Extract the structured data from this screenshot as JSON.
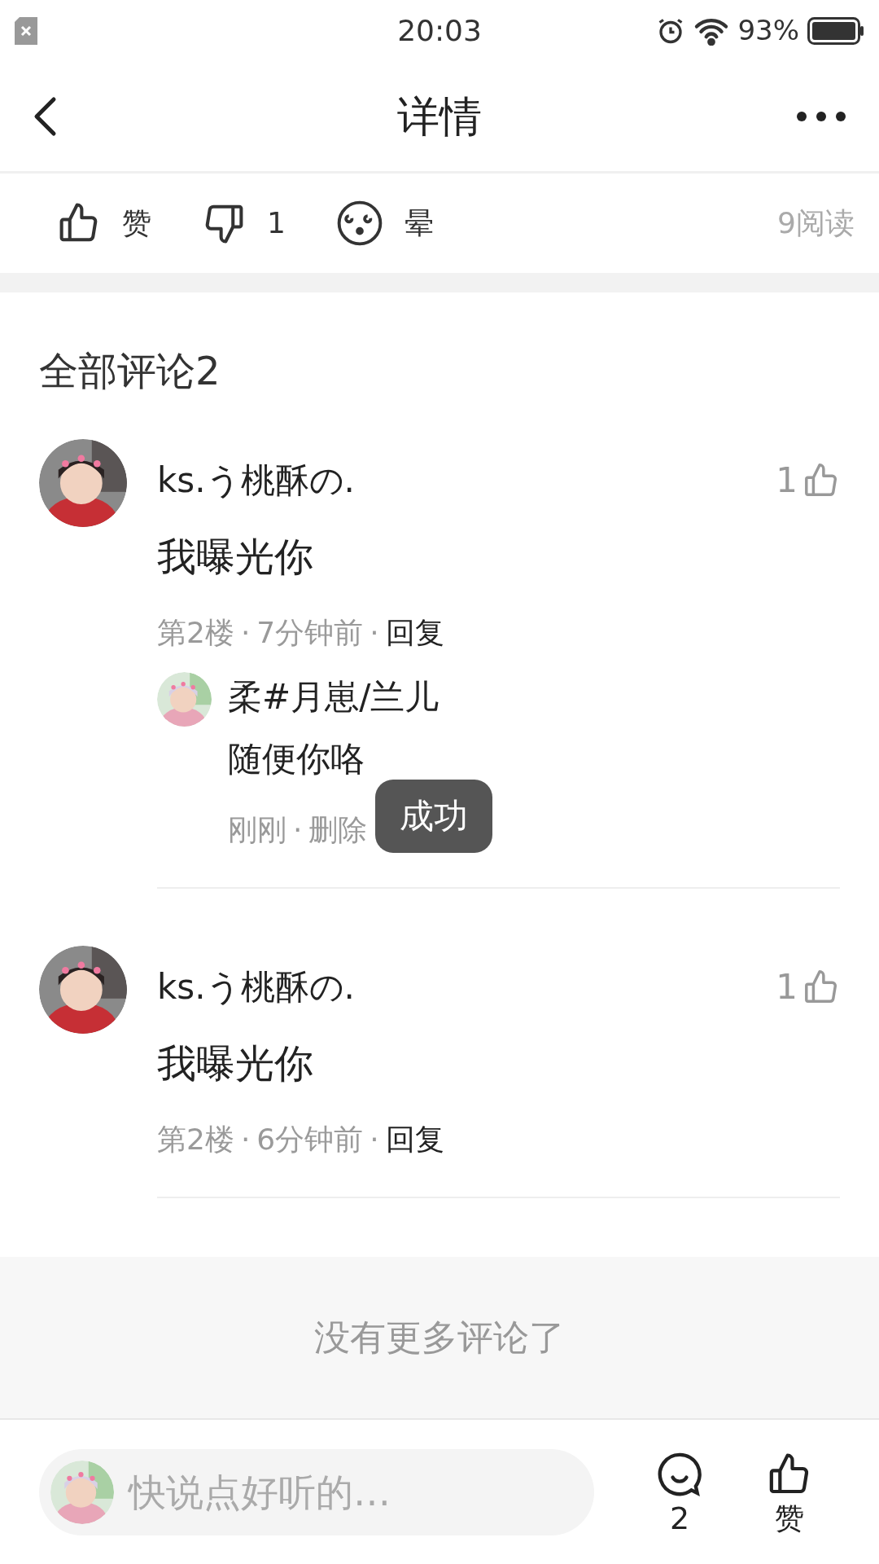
{
  "status_bar": {
    "time": "20:03",
    "battery": "93%"
  },
  "header": {
    "title": "详情"
  },
  "reactions": [
    {
      "kind": "like",
      "label": "赞"
    },
    {
      "kind": "dislike",
      "label": "1"
    },
    {
      "kind": "dizzy",
      "label": "晕"
    }
  ],
  "reads": "9阅读",
  "comments_title": "全部评论2",
  "separator": "·",
  "comments": [
    {
      "name": "ks.う桃酥の.",
      "likes": "1",
      "text": "我曝光你",
      "meta": [
        "第2楼",
        "7分钟前"
      ],
      "reply_action": "回复",
      "replies": [
        {
          "name": "柔#月崽/兰儿",
          "text": "随便你咯",
          "meta": [
            "刚刚",
            "删除"
          ]
        }
      ]
    },
    {
      "name": "ks.う桃酥の.",
      "likes": "1",
      "text": "我曝光你",
      "meta": [
        "第2楼",
        "6分钟前"
      ],
      "reply_action": "回复"
    }
  ],
  "end_note": "没有更多评论了",
  "toast": "成功",
  "bottom_bar": {
    "placeholder": "快说点好听的…",
    "comment_count": "2",
    "like_label": "赞"
  }
}
